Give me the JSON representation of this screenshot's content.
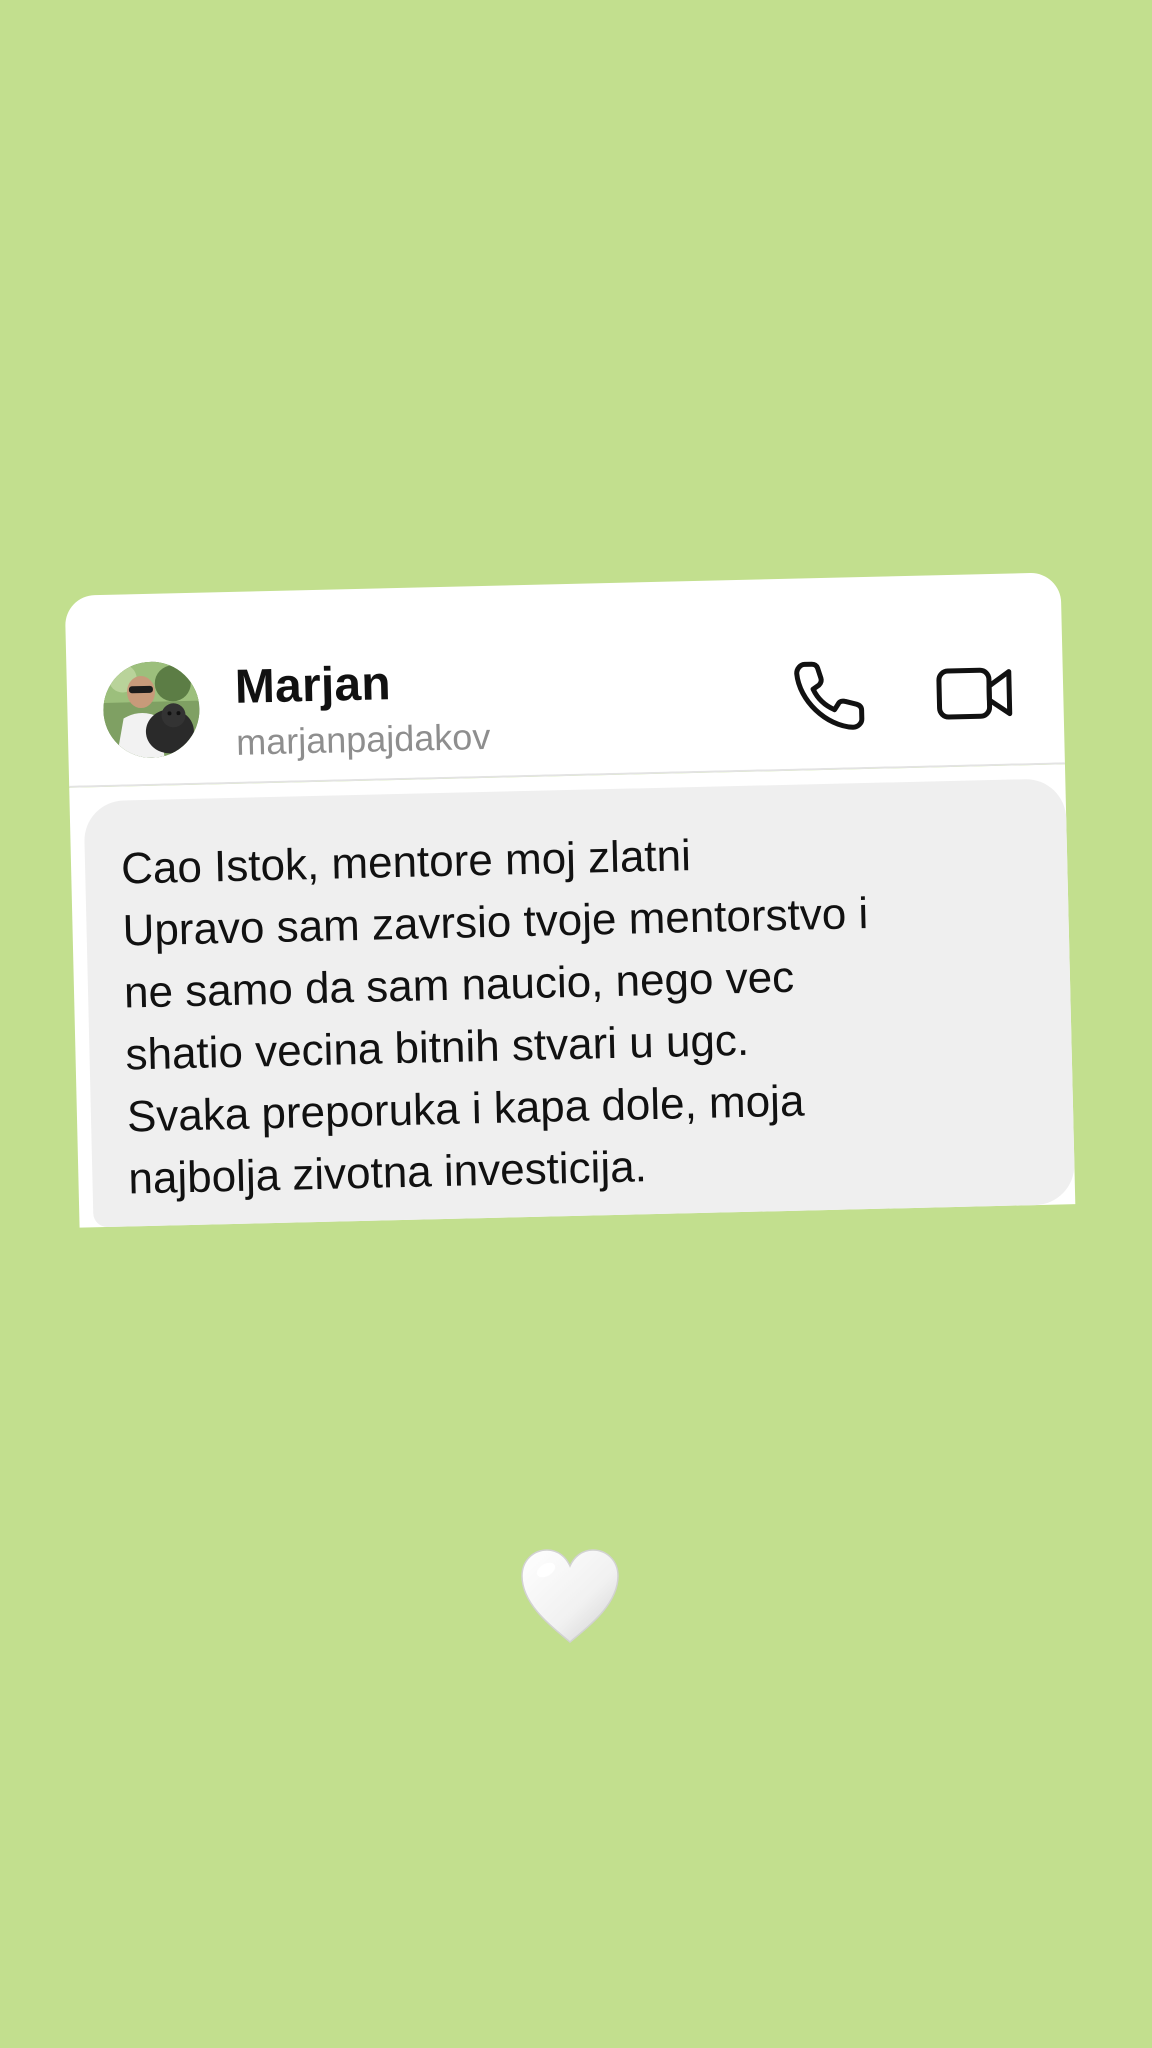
{
  "background_color": "#c2df8e",
  "chat_card": {
    "header": {
      "avatar_icon": "profile-photo-avatar",
      "name": "Marjan",
      "username": "marjanpajdakov",
      "call_icon": "phone-icon",
      "video_icon": "video-camera-icon"
    },
    "message": {
      "bubble_color": "#efefef",
      "lines": [
        "Cao Istok, mentore moj zlatni",
        "Upravo sam zavrsio tvoje mentorstvo i",
        "ne samo da sam naucio, nego vec",
        "shatio vecina bitnih stvari u ugc.",
        "Svaka preporuka i kapa dole, moja",
        "najbolja zivotna investicija."
      ]
    }
  },
  "sticker": {
    "icon": "white-heart-icon"
  }
}
